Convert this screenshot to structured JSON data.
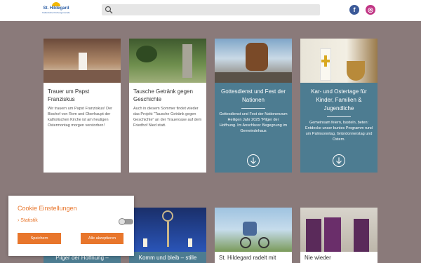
{
  "header": {
    "logo_name": "St. Hildegard",
    "logo_sub": "Katholische Kirchengemeinde",
    "search_placeholder": "",
    "facebook": "f",
    "instagram": "◎"
  },
  "cards_top": [
    {
      "title": "Trauer um Papst Franziskus",
      "text": "Wir trauern um Papst Franziskus! Der Bischof von Rom und Oberhaupt der katholischen Kirche ist am heutigen Ostermontag morgen verstorben!"
    },
    {
      "title": "Tausche Getränk gegen Geschichte",
      "text": "Auch in diesem Sommer findet wieder das Projekt \"Tausche Getränk gegen Geschichte\" an der Traueroase auf dem Friedhof Nied statt."
    },
    {
      "title": "Gottesdienst und Fest der Nationen",
      "text": "Gottesdienst und Fest der Nationenzum Heiligen Jahr 2025 \"Pilger der Hoffnung. Im Anschluss: Begegnung im Gemeindehaus"
    },
    {
      "title": "Kar- und Ostertage für Kinder, Familien & Jugendliche",
      "text": "Gemeinsam feiern, basteln, beten: Entdecke unser buntes Programm rund um Palmsonntag, Gründonnerstag und Ostern."
    }
  ],
  "cards_bottom": [
    {
      "title": "Pilger der Hoffnung –"
    },
    {
      "title": "Komm und bleib – stille"
    },
    {
      "title": "St. Hildegard radelt mit"
    },
    {
      "title": "Nie wieder"
    }
  ],
  "cookie": {
    "title": "Cookie Einstellungen",
    "statistik": "Statistik",
    "save_label": "Speichern",
    "accept_all_label": "Alle akzeptieren",
    "statistik_enabled": false
  },
  "colors": {
    "accent": "#e8762c",
    "teal": "#4d7c91",
    "background": "#8a7a7a"
  }
}
